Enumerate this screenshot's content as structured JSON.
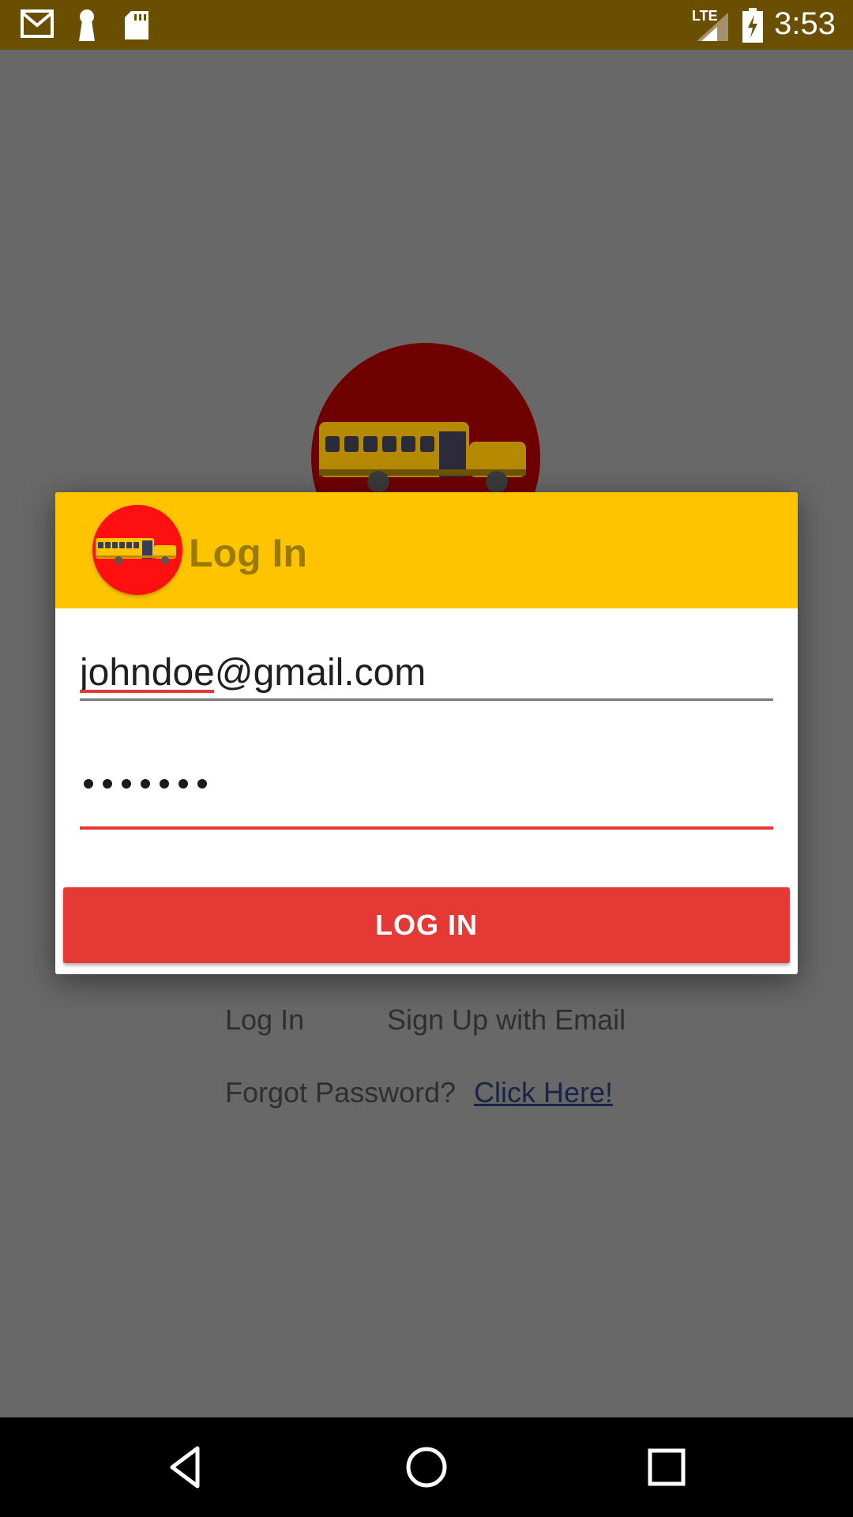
{
  "status_bar": {
    "time": "3:53",
    "network_label": "LTE",
    "icons": [
      "gmail-icon",
      "keyhole-icon",
      "sd-card-icon",
      "signal-icon",
      "battery-charging-icon"
    ]
  },
  "background": {
    "login_link": "Log In",
    "signup_link": "Sign Up with Email",
    "forgot_text": "Forgot Password?",
    "click_here_link": "Click Here!"
  },
  "dialog": {
    "title": "Log In",
    "email_value": "johndoe@gmail.com",
    "password_mask_count": 7,
    "login_button": "LOG IN"
  },
  "colors": {
    "status_bar": "#6a4f00",
    "header": "#ffc400",
    "accent": "#e53935",
    "logo_bg": "#ff1010",
    "title_text": "#9a7a00"
  },
  "navigation": {
    "buttons": [
      "back-icon",
      "home-icon",
      "recents-icon"
    ]
  }
}
